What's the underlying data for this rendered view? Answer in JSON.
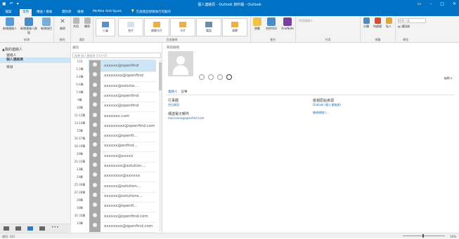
{
  "window": {
    "title": "個人連絡頁 - Outlook 資料檔 - Outlook"
  },
  "tabs": {
    "file": "檔案",
    "home": "常用",
    "send_receive": "傳送 / 接收",
    "folder": "資料夾",
    "view": "檢視",
    "mcafee": "McAfee Anti-Spam",
    "tell_me": "告訴我您想要執行的動作"
  },
  "ribbon": {
    "new_contact": "新增連絡人",
    "new_group": "新增連絡人群組",
    "new_items": "新增項目",
    "delete": "刪除",
    "share": "共用",
    "forward": "轉寄",
    "view_person": "人員",
    "view_card": "名片",
    "view_business": "商務卡片",
    "view_card2": "卡片",
    "view_phone": "電話",
    "view_list": "清單",
    "move": "移動",
    "mail_merge": "合併列印",
    "onenote": "OneNote",
    "share_contacts": "共用連絡人",
    "tags_categorize": "分類",
    "tags_follow": "待處理",
    "tags_private": "私人",
    "search_people": "搜尋人員",
    "address_book": "通訊錄",
    "group_new": "新增",
    "group_delete": "刪除",
    "group_comm": "通訊",
    "group_view": "目前檢視",
    "group_actions": "動作",
    "group_share": "共用",
    "group_tags": "標籤",
    "group_find": "尋找"
  },
  "nav": {
    "header": "▲我的連絡人",
    "items": [
      "連絡人",
      "個人連絡頁",
      "目錄"
    ]
  },
  "list": {
    "header": "通訊",
    "search_placeholder": "搜尋 個人連絡頁 (Ctrl+E)",
    "letters": [
      "123",
      "1-2筆",
      "3-4筆",
      "5-6筆",
      "7-8筆",
      "9筆",
      "10筆",
      "11-12筆",
      "13-14筆",
      "15筆",
      "16-17筆",
      "18-19筆",
      "20筆",
      "21-22筆",
      "23筆",
      "24筆",
      "25-26筆",
      "27-28筆",
      "29筆",
      "30筆",
      "31-32筆",
      "33筆"
    ],
    "contacts": [
      "xxxxxx@openfind",
      "xxxxxxxx@openfind",
      "xxxxxx@solutio...",
      "xxxxxx@openfind",
      "xxxxxx@openfind",
      "xxxxxxx.com",
      "xxxxxxxxx@openfind.com",
      "xxxxxx@openfi...",
      "xxxxxx@enfind...",
      "xxxxxx@xxxxx",
      "xxxxxxxx@solution...",
      "xxxxxxxx@xxxxxx",
      "xxxxxx@solution...",
      "xxxxxx@solutions...",
      "xxxxxx@openfi...",
      "xxxxxx@openfind.com",
      "xxxxxxxx@openfind.com"
    ]
  },
  "reading": {
    "header": "目前檢視",
    "tab_contact": "連絡人",
    "tab_notes": "記事",
    "edit": "編輯",
    "work_label": "行事曆",
    "work_value": "空白資訊",
    "email_label": "傳送電子郵件",
    "email_value": "marconne@openfind.com",
    "outlook_label": "檢視原始來源",
    "outlook_value": "Outlook (個人連絡頁)",
    "more_value": "檢視連絡人..."
  },
  "status": {
    "left": "項目: 141",
    "zoom": "10%"
  }
}
